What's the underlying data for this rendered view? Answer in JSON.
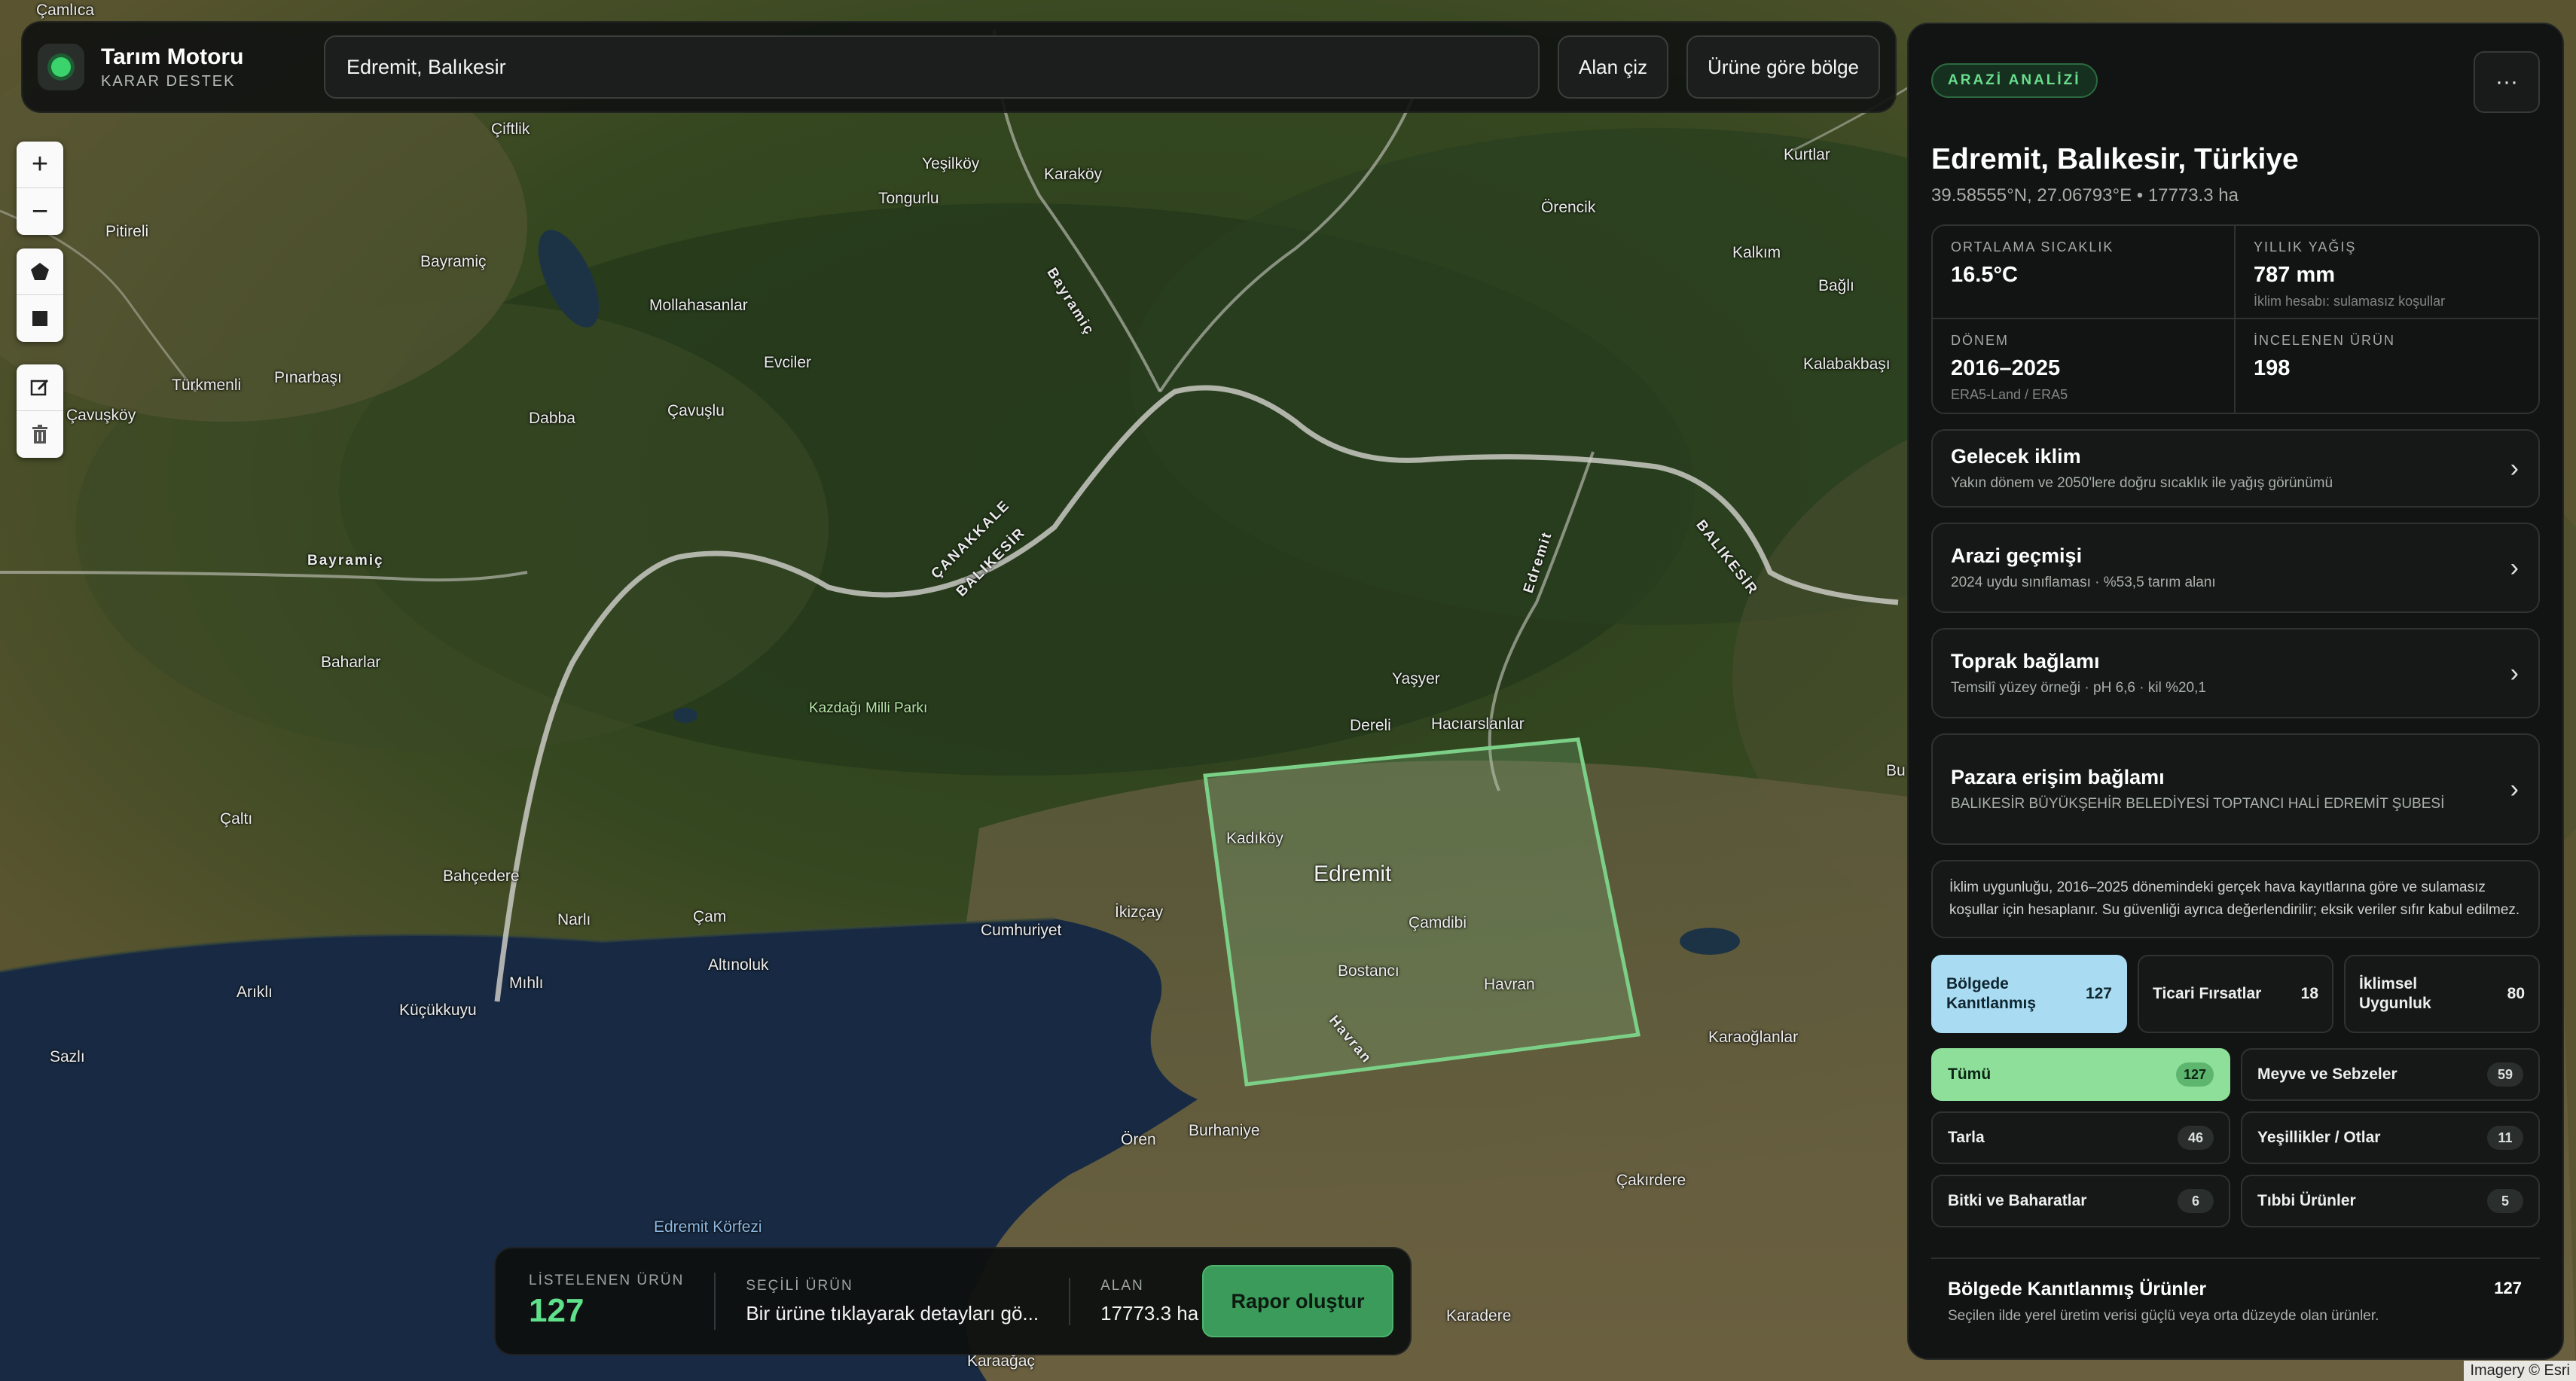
{
  "app": {
    "title": "Tarım Motoru",
    "subtitle": "KARAR DESTEK"
  },
  "search": {
    "value": "Edremit, Balıkesir"
  },
  "toolbar": {
    "draw_area": "Alan çiz",
    "region_by_product": "Ürüne göre bölge"
  },
  "map_tools": {
    "zoom_in": "+",
    "zoom_out": "−"
  },
  "map": {
    "attribution": "Imagery © Esri",
    "places": {
      "camlica": "Çamlıca",
      "ciftlik": "Çiftlik",
      "yesilkoy": "Yeşilköy",
      "karakoy": "Karaköy",
      "tongurlu": "Tongurlu",
      "kurtlar": "Kurtlar",
      "orencik": "Örencik",
      "pitireli": "Pitireli",
      "bayramic_n": "Bayramiç",
      "mollahasanlar": "Mollahasanlar",
      "bayramic_road": "Bayramiç",
      "kalkim": "Kalkım",
      "bagli": "Bağlı",
      "evciler": "Evciler",
      "kalabakbasi": "Kalabakbaşı",
      "turkmenli": "Türkmenli",
      "pinarbasi": "Pınarbaşı",
      "cavuskoy": "Çavuşköy",
      "dabba": "Dabba",
      "cavuslu": "Çavuşlu",
      "bayramic_w": "Bayramiç",
      "canakkale": "ÇANAKKALE",
      "balikesir_w": "BALIKESİR",
      "edremit_road": "Edremit",
      "balikesir_e": "BALIKESİR",
      "baharlar": "Baharlar",
      "kazdagi": "Kazdağı Milli Parkı",
      "yasyer": "Yaşyer",
      "dereli": "Dereli",
      "hacilarslanlar": "Hacıarslanlar",
      "bu": "Bu",
      "calti": "Çaltı",
      "kadikoy": "Kadıköy",
      "edremit": "Edremit",
      "bahcedere": "Bahçedere",
      "narli": "Narlı",
      "cam": "Çam",
      "ikizcay": "İkizçay",
      "cumhuriyet": "Cumhuriyet",
      "camdibi": "Çamdibi",
      "altinoluk": "Altınoluk",
      "bostanci": "Bostancı",
      "havran": "Havran",
      "havran_road": "Havran",
      "arikli": "Arıklı",
      "mihli": "Mıhlı",
      "kucukkuyu": "Küçükkuyu",
      "karaoglanlar": "Karaoğlanlar",
      "sazli": "Sazlı",
      "oren": "Ören",
      "burhaniye": "Burhaniye",
      "cakirdere": "Çakırdere",
      "edremit_korfezi": "Edremit Körfezi",
      "karadere": "Karadere",
      "karaagac": "Karaağaç"
    }
  },
  "bottom_bar": {
    "listed_label": "LİSTELENEN ÜRÜN",
    "listed_value": "127",
    "selected_label": "SEÇİLİ ÜRÜN",
    "selected_value": "Bir ürüne tıklayarak detayları gö...",
    "area_label": "ALAN",
    "area_value": "17773.3 ha",
    "report_button": "Rapor oluştur"
  },
  "panel": {
    "badge": "ARAZİ ANALİZİ",
    "more": "···",
    "title": "Edremit, Balıkesir, Türkiye",
    "subtitle": "39.58555°N, 27.06793°E • 17773.3 ha",
    "stats": [
      {
        "label": "ORTALAMA SICAKLIK",
        "value": "16.5°C",
        "note": ""
      },
      {
        "label": "YILLIK YAĞIŞ",
        "value": "787 mm",
        "note": "İklim hesabı: sulamasız koşullar"
      },
      {
        "label": "DÖNEM",
        "value": "2016–2025",
        "note": "ERA5-Land / ERA5"
      },
      {
        "label": "İNCELENEN ÜRÜN",
        "value": "198",
        "note": ""
      }
    ],
    "cards": [
      {
        "title": "Gelecek iklim",
        "sub": "Yakın dönem ve 2050'lere doğru sıcaklık ile yağış görünümü"
      },
      {
        "title": "Arazi geçmişi",
        "sub": "2024 uydu sınıflaması · %53,5 tarım alanı"
      },
      {
        "title": "Toprak bağlamı",
        "sub": "Temsilî yüzey örneği · pH 6,6 · kil %20,1"
      },
      {
        "title": "Pazara erişim bağlamı",
        "sub": "BALIKESİR BÜYÜKŞEHİR BELEDİYESİ TOPTANCI HALİ EDREMİT ŞUBESİ"
      }
    ],
    "info": "İklim uygunluğu, 2016–2025 dönemindeki gerçek hava kayıtlarına göre ve sulamasız koşullar için hesaplanır. Su güvenliği ayrıca değerlendirilir; eksik veriler sıfır kabul edilmez.",
    "segments": [
      {
        "label": "Bölgede Kanıtlanmış",
        "count": "127"
      },
      {
        "label": "Ticari Fırsatlar",
        "count": "18"
      },
      {
        "label": "İklimsel Uygunluk",
        "count": "80"
      }
    ],
    "categories": [
      {
        "label": "Tümü",
        "count": "127"
      },
      {
        "label": "Meyve ve Sebzeler",
        "count": "59"
      },
      {
        "label": "Tarla",
        "count": "46"
      },
      {
        "label": "Yeşillikler / Otlar",
        "count": "11"
      },
      {
        "label": "Bitki ve Baharatlar",
        "count": "6"
      },
      {
        "label": "Tıbbi Ürünler",
        "count": "5"
      }
    ],
    "summary": {
      "title": "Bölgede Kanıtlanmış Ürünler",
      "sub": "Seçilen ilde yerel üretim verisi güçlü veya orta düzeyde olan ürünler.",
      "count": "127"
    }
  },
  "colors": {
    "accent_green": "#3bd36b",
    "active_segment": "#a9dcf2",
    "active_category": "#8ddf99",
    "report_button": "#3b9b5a"
  }
}
